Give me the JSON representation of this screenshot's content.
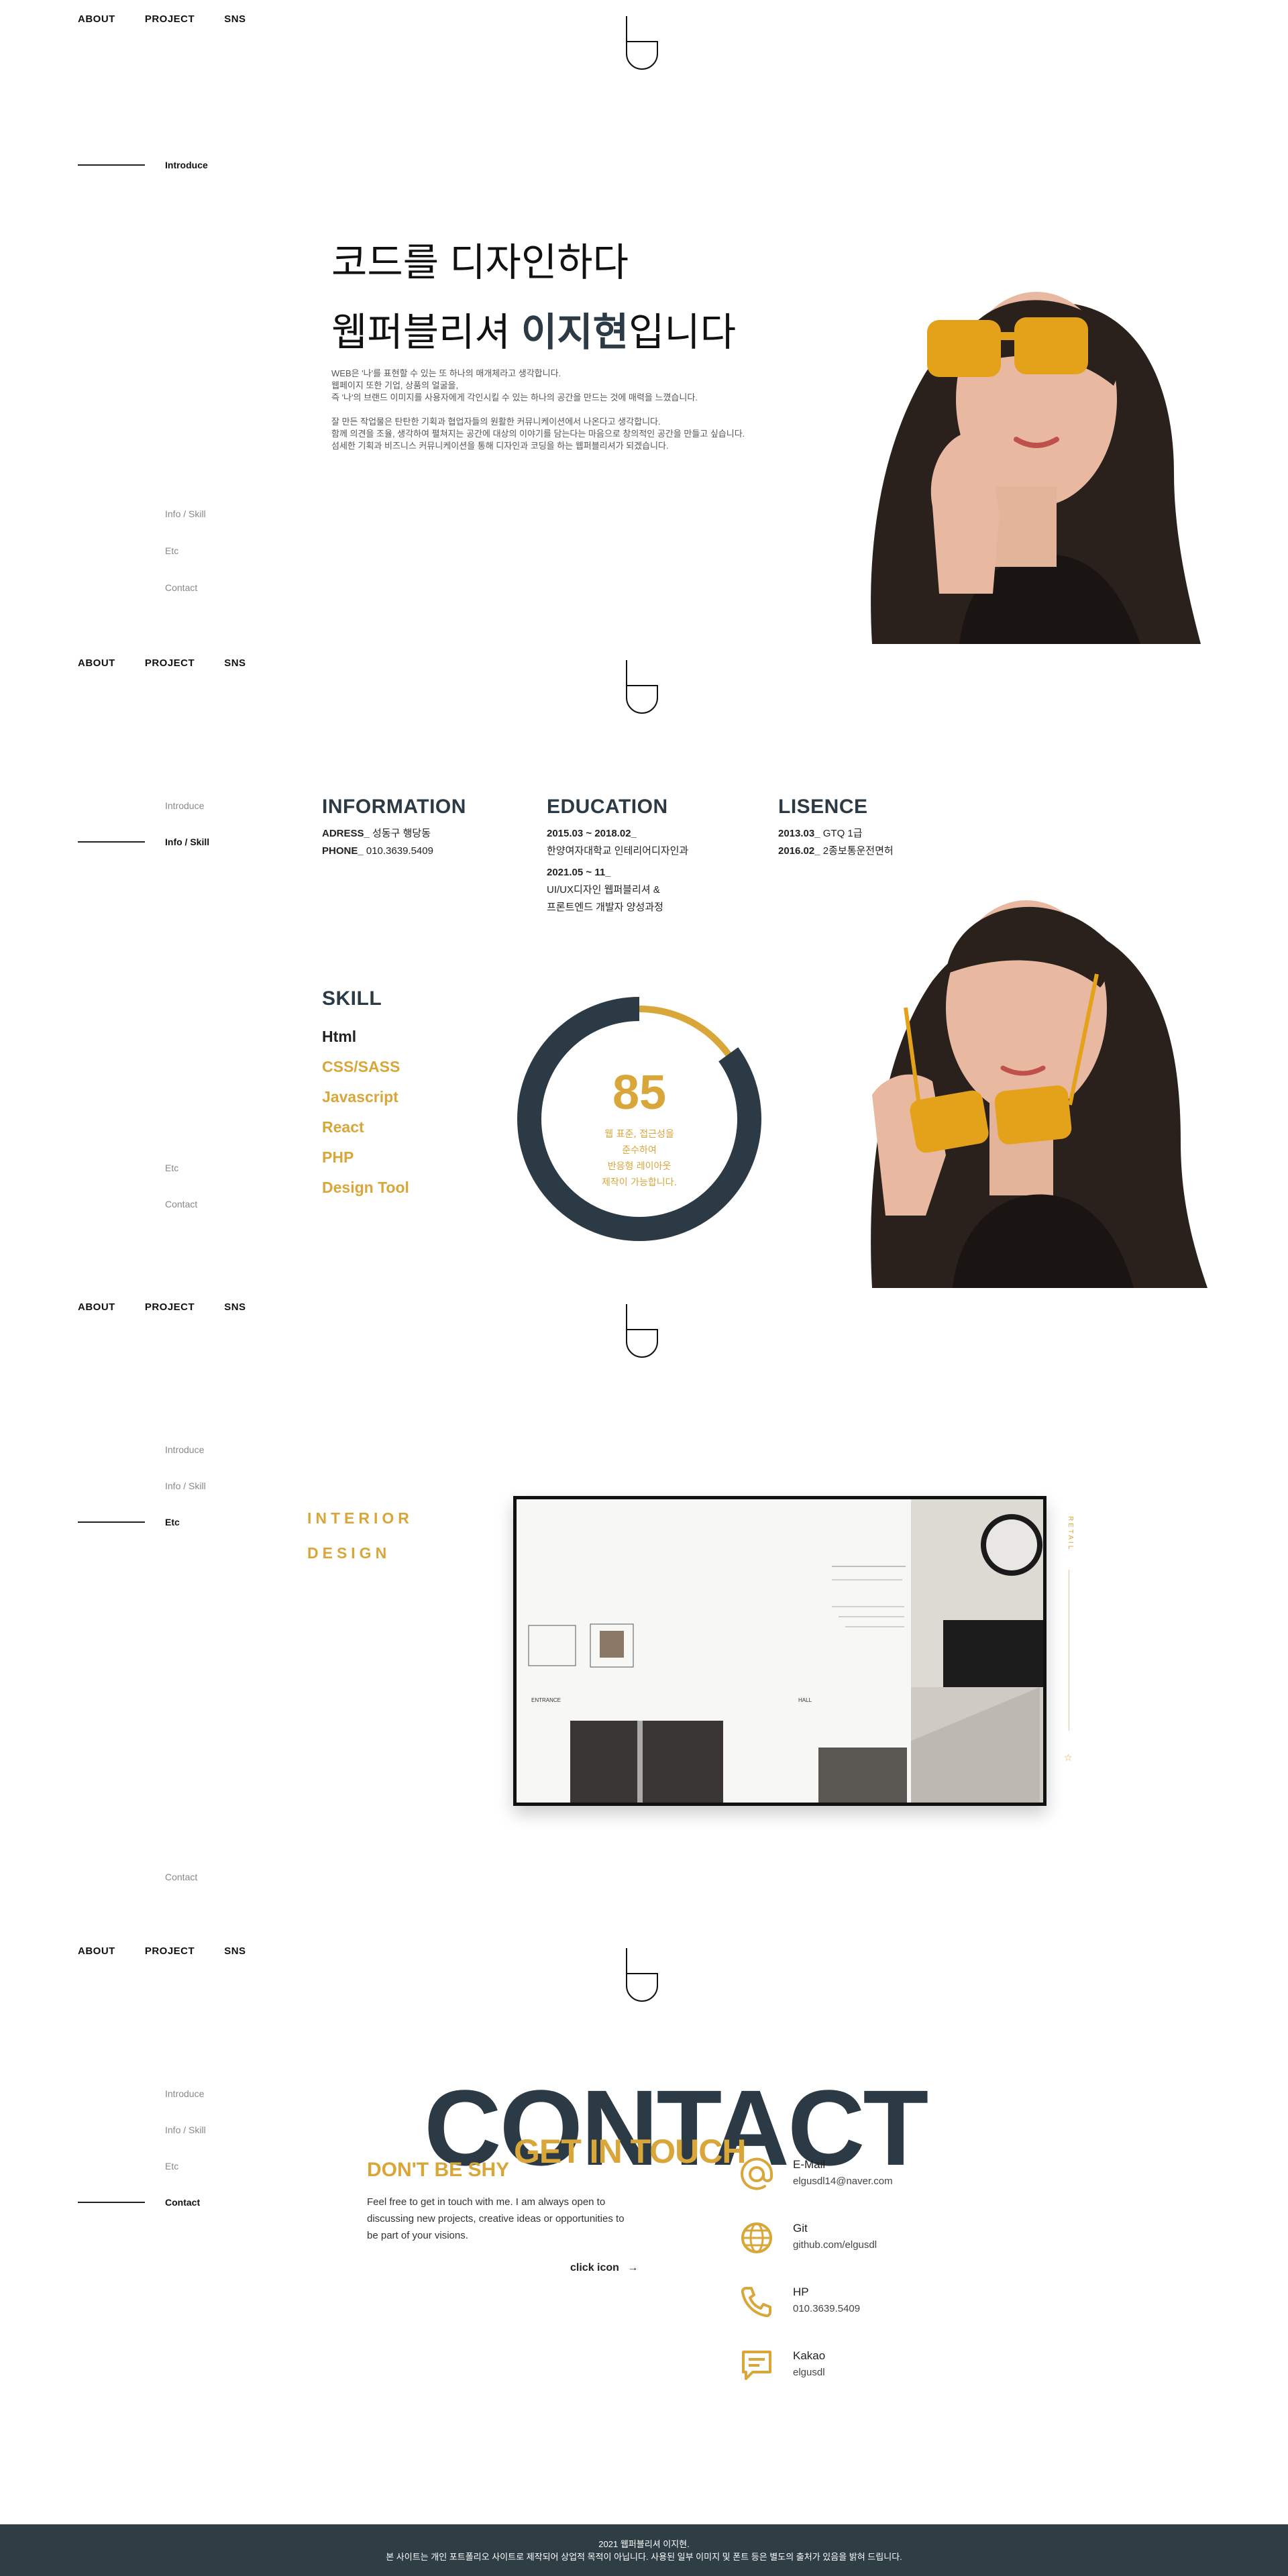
{
  "nav": {
    "about": "ABOUT",
    "project": "PROJECT",
    "sns": "SNS"
  },
  "sidebar": {
    "introduce": "Introduce",
    "info_skill": "Info / Skill",
    "etc": "Etc",
    "contact": "Contact"
  },
  "intro": {
    "title_line1": "코드를 디자인하다",
    "title_line2_prefix": "웹퍼블리셔 ",
    "name": "이지현",
    "title_line2_suffix": "입니다",
    "para1": [
      "WEB은 '나'를 표현할 수 있는 또 하나의 매개체라고 생각합니다.",
      "웹페이지 또한 기업, 상품의 얼굴을,",
      "즉 '나'의 브랜드 이미지를 사용자에게 각인시킬 수 있는 하나의 공간을 만드는 것에 매력을 느꼈습니다."
    ],
    "para2": [
      "잘 만든 작업물은 탄탄한 기획과 협업자들의 원활한 커뮤니케이션에서 나온다고 생각합니다.",
      "함께 의견을 조율, 생각하여 펼쳐지는 공간에 대상의 이야기를 담는다는 마음으로 창의적인 공간을 만들고 싶습니다.",
      "섬세한 기획과 비즈니스 커뮤니케이션을 통해 디자인과 코딩을 하는 웹퍼블리셔가 되겠습니다."
    ]
  },
  "info": {
    "information_title": "INFORMATION",
    "address_label": "ADRESS_",
    "address_value": "성동구 행당동",
    "phone_label": "PHONE_",
    "phone_value": "010.3639.5409",
    "education_title": "EDUCATION",
    "edu1_date": "2015.03 ~ 2018.02_",
    "edu1_desc": "한양여자대학교 인테리어디자인과",
    "edu2_date": "2021.05 ~ 11_",
    "edu2_desc1": "UI/UX디자인 웹퍼블리셔 &",
    "edu2_desc2": "프론트엔드 개발자 양성과정",
    "licence_title": "LISENCE",
    "lic1_date": "2013.03_",
    "lic1_desc": "GTQ 1급",
    "lic2_date": "2016.02_",
    "lic2_desc": "2종보통운전면허",
    "skill_title": "SKILL",
    "skills": [
      "Html",
      "CSS/SASS",
      "Javascript",
      "React",
      "PHP",
      "Design Tool"
    ],
    "donut_value": "85",
    "donut_percent": 85,
    "donut_text": [
      "웹 표준, 접근성을",
      "준수하여",
      "반응형 레이아웃",
      "제작이 가능합니다."
    ]
  },
  "project": {
    "label_line1": "INTERIOR",
    "label_line2": "DESIGN",
    "side_label": "RETAIL",
    "entrance": "ENTRANCE",
    "hall": "HALL"
  },
  "contact": {
    "big": "CONTACT",
    "sub": "GET IN TOUCH",
    "shy_title": "DON'T BE SHY",
    "shy_text": [
      "Feel free to get in touch with me. I am always open to",
      "discussing new projects, creative ideas or opportunities to",
      "be part of your visions."
    ],
    "click": "click icon",
    "items": [
      {
        "label": "E-Mail",
        "value": "elgusdl14@naver.com",
        "icon": "at-icon"
      },
      {
        "label": "Git",
        "value": "github.com/elgusdl",
        "icon": "globe-icon"
      },
      {
        "label": "HP",
        "value": "010.3639.5409",
        "icon": "phone-icon"
      },
      {
        "label": "Kakao",
        "value": "elgusdl",
        "icon": "chat-icon"
      }
    ]
  },
  "footer": {
    "line1": "2021 웹퍼블리셔 이지현.",
    "line2": "본 사이트는 개인 포트폴리오 사이트로 제작되어 상업적 목적이 아닙니다. 사용된 일부 이미지 및 폰트 등은 별도의 출처가 있음을 밝혀 드립니다."
  },
  "colors": {
    "accent": "#d9a63a",
    "dark": "#2b3a44",
    "footer": "#2f3d45"
  }
}
